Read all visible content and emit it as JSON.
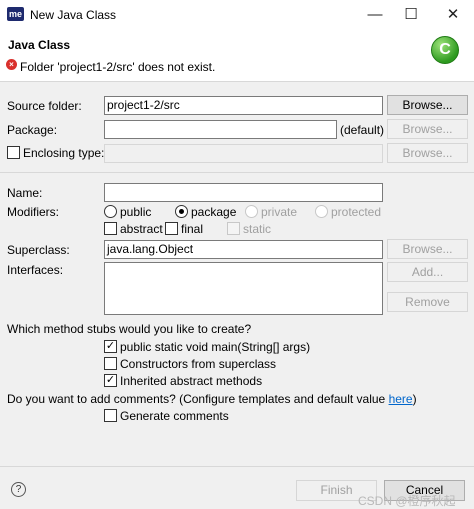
{
  "window": {
    "app_icon": "me",
    "title": "New Java Class",
    "minimize": "—",
    "maximize": "☐",
    "close": "✕"
  },
  "header": {
    "title": "Java Class",
    "error_message": "Folder 'project1-2/src' does not exist.",
    "wizard_icon_letter": "C"
  },
  "form": {
    "source_folder": {
      "label": "Source folder:",
      "value": "project1-2/src",
      "button": "Browse..."
    },
    "package": {
      "label": "Package:",
      "value": "",
      "default_label": "(default)",
      "button": "Browse..."
    },
    "enclosing_type": {
      "label": "Enclosing type:",
      "value": "",
      "button": "Browse...",
      "checked": false
    },
    "name": {
      "label": "Name:",
      "value": ""
    },
    "modifiers": {
      "label": "Modifiers:",
      "access": [
        "public",
        "package",
        "private",
        "protected"
      ],
      "selected": "package",
      "abstract": "abstract",
      "final": "final",
      "static": "static"
    },
    "superclass": {
      "label": "Superclass:",
      "value": "java.lang.Object",
      "button": "Browse..."
    },
    "interfaces": {
      "label": "Interfaces:",
      "add_button": "Add...",
      "remove_button": "Remove"
    },
    "stubs": {
      "question": "Which method stubs would you like to create?",
      "main": "public static void main(String[] args)",
      "constructors": "Constructors from superclass",
      "inherited": "Inherited abstract methods"
    },
    "comments": {
      "question": "Do you want to add comments? (Configure templates and default value ",
      "link": "here",
      "close_paren": ")",
      "generate": "Generate comments"
    }
  },
  "footer": {
    "help": "?",
    "finish": "Finish",
    "cancel": "Cancel",
    "watermark": "CSDN @橙序秋起791"
  }
}
